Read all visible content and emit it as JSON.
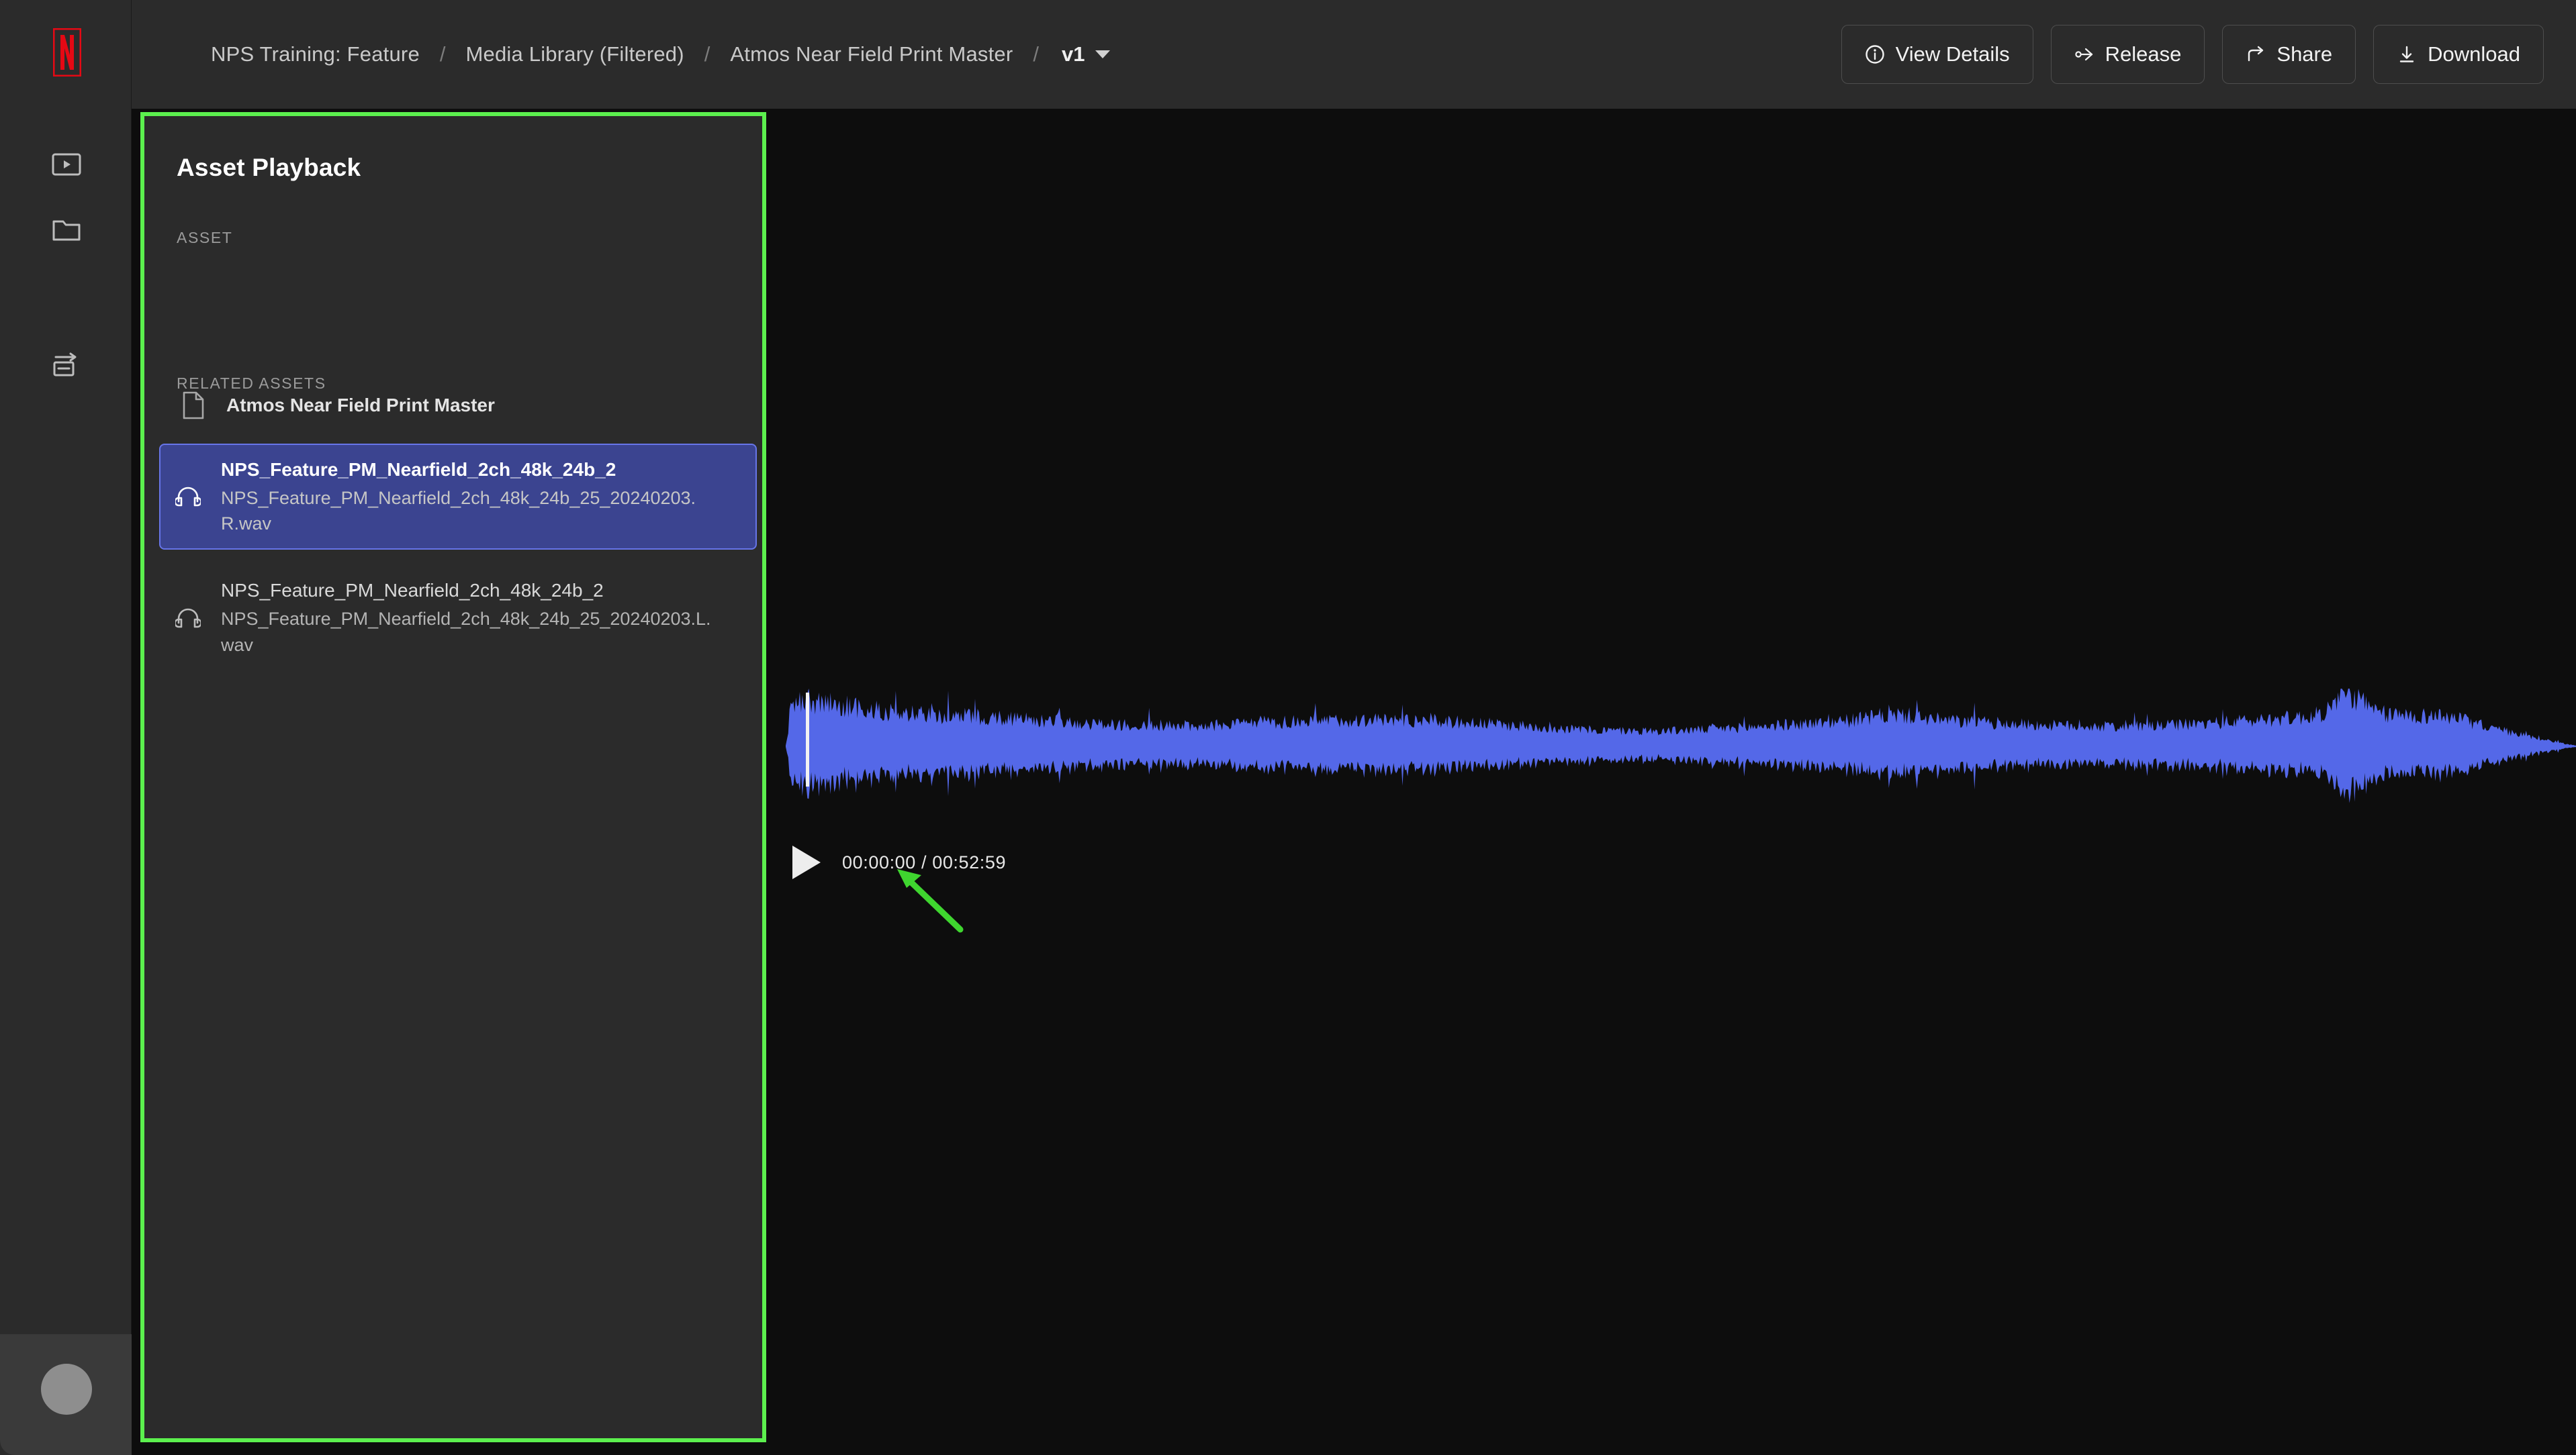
{
  "app": {
    "brand_icon": "netflix-logo",
    "accent_green": "#5cf04e",
    "waveform_color": "#5468e8",
    "selected_item_bg": "#3b4490"
  },
  "rail": {
    "items": [
      {
        "icon": "media-player-icon",
        "label": "Media Player"
      },
      {
        "icon": "folder-icon",
        "label": "Folders"
      },
      {
        "icon": "transfer-box-icon",
        "label": "Transfers"
      }
    ],
    "avatar": {
      "icon": "user-avatar",
      "label": "User"
    }
  },
  "breadcrumb": {
    "items": [
      "NPS Training: Feature",
      "Media Library (Filtered)",
      "Atmos Near Field Print Master"
    ],
    "separator": "/",
    "version": "v1",
    "version_caret": "chevron-down-icon"
  },
  "actions": [
    {
      "label": "View Details",
      "icon": "info-circle-icon"
    },
    {
      "label": "Release",
      "icon": "release-branch-icon"
    },
    {
      "label": "Share",
      "icon": "share-arrow-icon"
    },
    {
      "label": "Download",
      "icon": "download-icon"
    }
  ],
  "panel": {
    "title": "Asset Playback",
    "asset_label": "ASSET",
    "asset": {
      "name": "Atmos Near Field Print Master",
      "icon": "file-icon"
    },
    "related_label": "RELATED ASSETS",
    "related": [
      {
        "title": "NPS_Feature_PM_Nearfield_2ch_48k_24b_2",
        "filename": "NPS_Feature_PM_Nearfield_2ch_48k_24b_25_20240203.R.wav",
        "icon": "headphones-icon",
        "selected": true
      },
      {
        "title": "NPS_Feature_PM_Nearfield_2ch_48k_24b_2",
        "filename": "NPS_Feature_PM_Nearfield_2ch_48k_24b_25_20240203.L.wav",
        "icon": "headphones-icon",
        "selected": false
      }
    ]
  },
  "player": {
    "play_icon": "play-icon",
    "current_time": "00:00:00",
    "duration": "00:52:59",
    "time_display": "00:00:00 / 00:52:59",
    "playhead_position": "00:00:00"
  },
  "annotation": {
    "arrow_color": "#3fd62f",
    "target": "play-button",
    "panel_highlight": "asset-playback-panel"
  }
}
